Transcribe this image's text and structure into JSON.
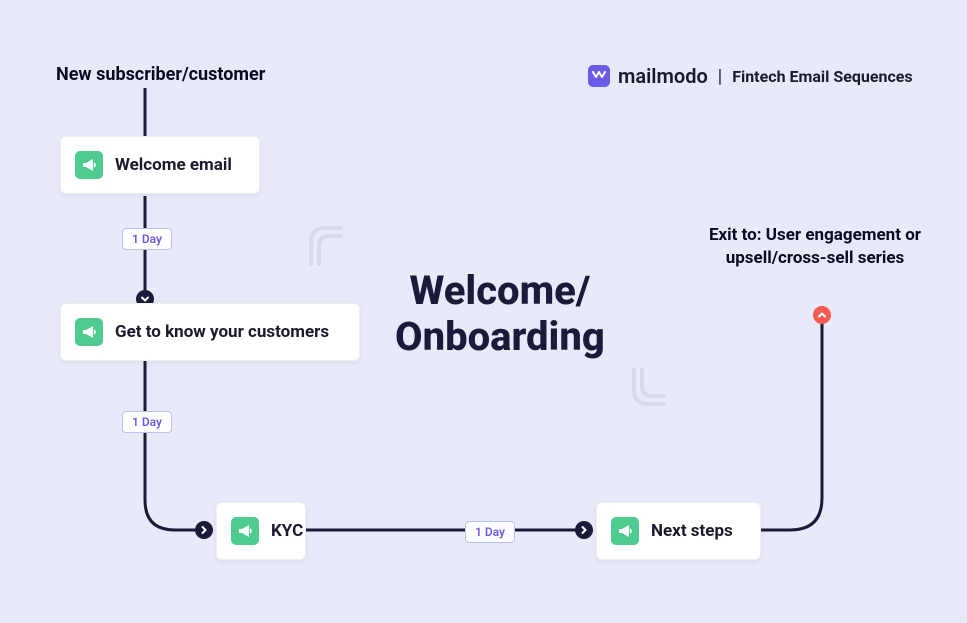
{
  "header": {
    "start_label": "New subscriber/customer",
    "brand_name": "mailmodo",
    "brand_sub": "Fintech Email Sequences"
  },
  "flow": {
    "title_line1": "Welcome/",
    "title_line2": "Onboarding",
    "exit_line1": "Exit to: User engagement or",
    "exit_line2": "upsell/cross-sell series"
  },
  "nodes": {
    "welcome": "Welcome email",
    "know": "Get to know your customers",
    "kyc": "KYC",
    "next": "Next steps"
  },
  "delays": {
    "d1": "1 Day",
    "d2": "1 Day",
    "d3": "1 Day"
  }
}
